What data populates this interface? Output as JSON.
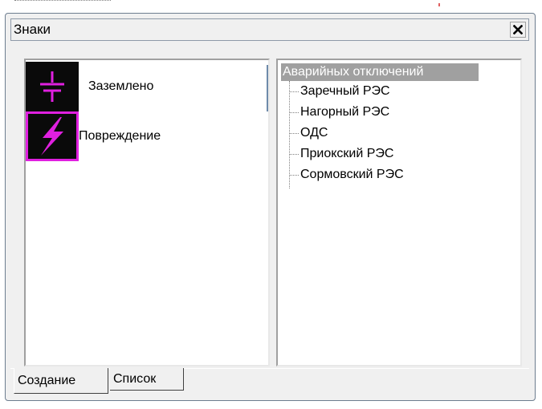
{
  "window": {
    "title": "Знаки",
    "close_icon": "close-icon"
  },
  "signs": [
    {
      "label": "Заземлено",
      "icon": "ground-icon",
      "icon_color": "#e020e0",
      "selected": false
    },
    {
      "label": "Повреждение",
      "icon": "lightning-icon",
      "icon_color": "#e020e0",
      "selected": true
    }
  ],
  "tree": {
    "root": "Аварийных отключений",
    "children": [
      "Заречный РЭС",
      "Нагорный РЭС",
      "ОДС",
      "Приокский РЭС",
      "Сормовский РЭС"
    ]
  },
  "tabs": [
    {
      "label": "Создание",
      "active": true
    },
    {
      "label": "Список",
      "active": false
    }
  ],
  "colors": {
    "accent": "#e020e0",
    "selection_bg": "#a0a0a0",
    "window_bg": "#f0f0f0"
  }
}
